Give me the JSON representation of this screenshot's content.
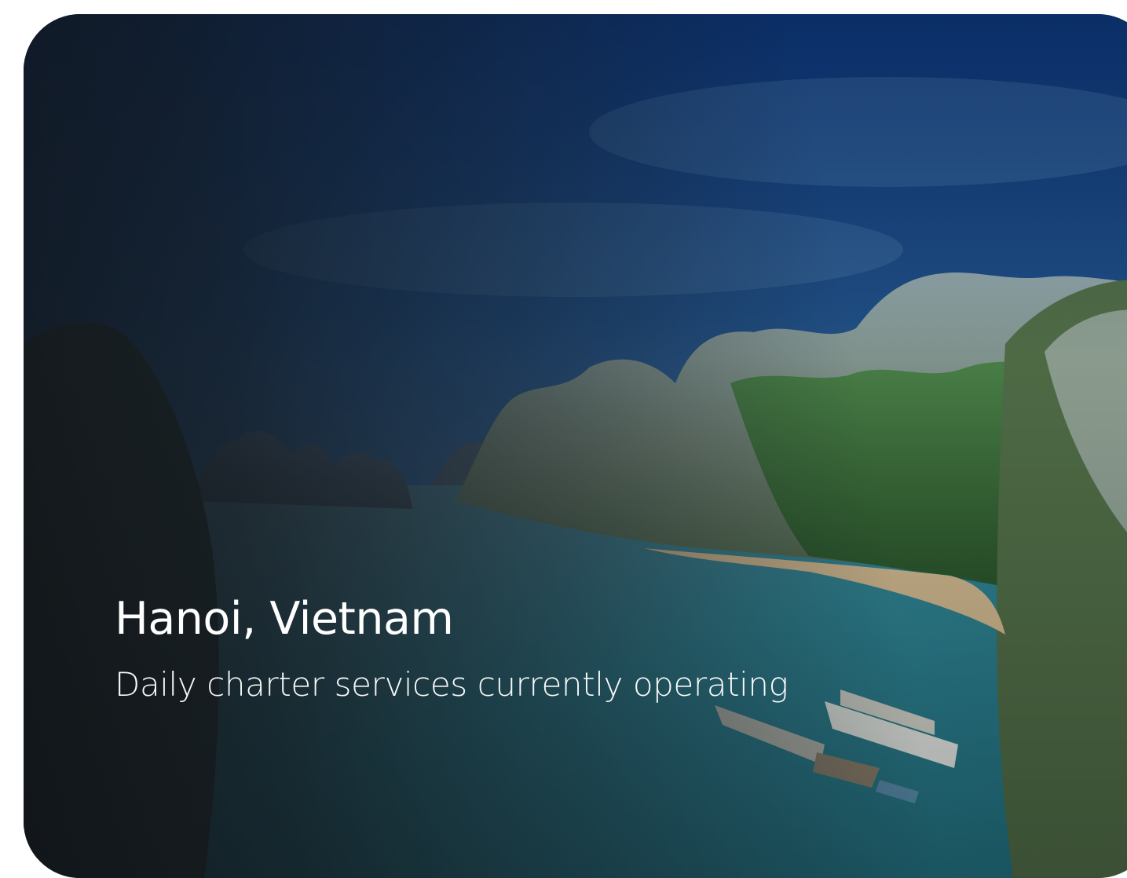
{
  "card": {
    "title": "Hanoi, Vietnam",
    "subtitle": "Daily charter services currently operating",
    "image": "halong-bay-karst-landscape"
  },
  "colors": {
    "sky_top": "#0d3a78",
    "sky_mid": "#2a5a8a",
    "water": "#2e8f96",
    "overlay_dark": "#1c1f23",
    "text": "#ffffff"
  }
}
